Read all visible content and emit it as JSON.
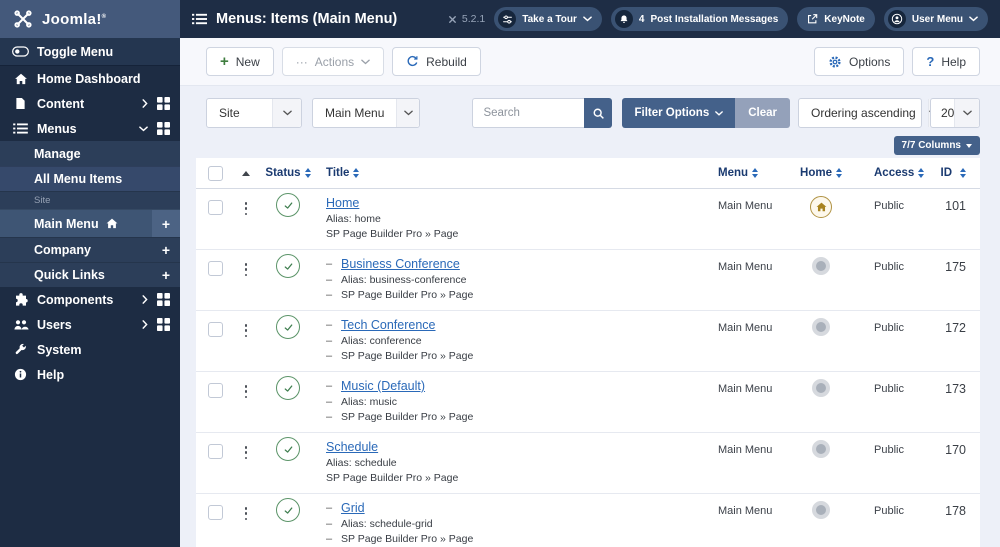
{
  "header": {
    "logo": "Joomla!",
    "logo_reg": "®",
    "title": "Menus: Items (Main Menu)",
    "version": "5.2.1",
    "take_a_tour": "Take a Tour",
    "messages_count": "4",
    "messages_label": "Post Installation Messages",
    "keynote": "KeyNote",
    "user_menu": "User Menu"
  },
  "sidebar": {
    "toggle_menu": "Toggle Menu",
    "home_dashboard": "Home Dashboard",
    "content": "Content",
    "menus": "Menus",
    "manage": "Manage",
    "all_menu_items": "All Menu Items",
    "site_section": "Site",
    "main_menu": "Main Menu",
    "company": "Company",
    "quick_links": "Quick Links",
    "components": "Components",
    "users": "Users",
    "system": "System",
    "help": "Help",
    "plus": "+"
  },
  "toolbar": {
    "new": "New",
    "actions": "Actions",
    "rebuild": "Rebuild",
    "options": "Options",
    "help": "Help"
  },
  "filters": {
    "site": "Site",
    "menu": "Main Menu",
    "search_placeholder": "Search",
    "filter_options": "Filter Options",
    "clear": "Clear",
    "ordering": "Ordering ascending",
    "per_page": "20",
    "columns": "7/7 Columns"
  },
  "table": {
    "dash": "–",
    "headers": {
      "status": "Status",
      "title": "Title",
      "menu": "Menu",
      "home": "Home",
      "access": "Access",
      "id": "ID"
    },
    "rows": [
      {
        "nested": false,
        "title": "Home",
        "alias": "Alias: home",
        "note": "SP Page Builder Pro » Page",
        "menu": "Main Menu",
        "home": true,
        "access": "Public",
        "id": "101"
      },
      {
        "nested": true,
        "title": "Business Conference",
        "alias": "Alias: business-conference",
        "note": "SP Page Builder Pro » Page",
        "menu": "Main Menu",
        "home": false,
        "access": "Public",
        "id": "175"
      },
      {
        "nested": true,
        "title": "Tech Conference",
        "alias": "Alias: conference",
        "note": "SP Page Builder Pro » Page",
        "menu": "Main Menu",
        "home": false,
        "access": "Public",
        "id": "172"
      },
      {
        "nested": true,
        "title": "Music (Default)",
        "alias": "Alias: music",
        "note": "SP Page Builder Pro » Page",
        "menu": "Main Menu",
        "home": false,
        "access": "Public",
        "id": "173"
      },
      {
        "nested": false,
        "title": "Schedule",
        "alias": "Alias: schedule",
        "note": "SP Page Builder Pro » Page",
        "menu": "Main Menu",
        "home": false,
        "access": "Public",
        "id": "170"
      },
      {
        "nested": true,
        "title": "Grid",
        "alias": "Alias: schedule-grid",
        "note": "SP Page Builder Pro » Page",
        "menu": "Main Menu",
        "home": false,
        "access": "Public",
        "id": "178"
      }
    ]
  }
}
